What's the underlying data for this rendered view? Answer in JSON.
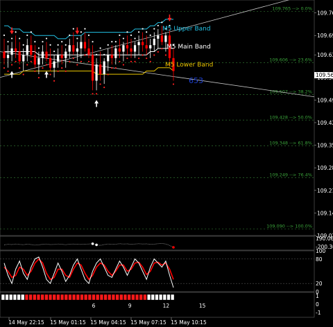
{
  "colors": {
    "background": "#000000",
    "grid": "#2f6f2f",
    "candle_up": "#ffffff",
    "candle_down": "#ff0000",
    "upper_band": "#22c3e6",
    "main_band": "#ffffff",
    "lower_band": "#e8c400",
    "fib": "#3aa23a",
    "price_label_bg": "#ffffff",
    "counter": "#1e40d0",
    "stoch_main": "#ffffff",
    "stoch_signal": "#ff0000"
  },
  "main_chart": {
    "current_price_label": "109.56",
    "countdown": "653",
    "band_labels": {
      "upper": "M5 Upper Band",
      "main": "M5 Main Band",
      "lower": "M5 Lower Band"
    }
  },
  "fib_labels": [
    {
      "text": "109.765 --> 0.0%",
      "price": 109.765
    },
    {
      "text": "109.606 --> 23.6%",
      "price": 109.606
    },
    {
      "text": "109.507 --> 38.2%",
      "price": 109.507
    },
    {
      "text": "109.428 --> 50.0%",
      "price": 109.428
    },
    {
      "text": "109.348 --> 61.8%",
      "price": 109.348
    },
    {
      "text": "109.249 --> 76.4%",
      "price": 109.249
    },
    {
      "text": "109.090 --> 100.0%",
      "price": 109.09
    }
  ],
  "chart_data": {
    "type": "line",
    "title": "",
    "y_ticks": [
      "109.76",
      "109.69",
      "109.63",
      "109.56",
      "109.49",
      "109.42",
      "109.35",
      "109.28",
      "109.21",
      "109.14",
      "109.07"
    ],
    "ylim": [
      109.07,
      109.8
    ],
    "x_ticks": [
      "14 May 22:15",
      "15 May 01:15",
      "15 May 04:15",
      "15 May 07:15",
      "15 May 10:15"
    ],
    "candles": [
      [
        109.64,
        109.68,
        109.6,
        109.62
      ],
      [
        109.62,
        109.66,
        109.59,
        109.63
      ],
      [
        109.63,
        109.67,
        109.61,
        109.65
      ],
      [
        109.65,
        109.69,
        109.62,
        109.64
      ],
      [
        109.64,
        109.67,
        109.6,
        109.61
      ],
      [
        109.61,
        109.65,
        109.58,
        109.63
      ],
      [
        109.63,
        109.68,
        109.61,
        109.66
      ],
      [
        109.66,
        109.69,
        109.62,
        109.63
      ],
      [
        109.63,
        109.66,
        109.59,
        109.6
      ],
      [
        109.6,
        109.64,
        109.57,
        109.62
      ],
      [
        109.62,
        109.66,
        109.6,
        109.64
      ],
      [
        109.64,
        109.67,
        109.61,
        109.62
      ],
      [
        109.62,
        109.65,
        109.58,
        109.59
      ],
      [
        109.59,
        109.63,
        109.56,
        109.61
      ],
      [
        109.61,
        109.65,
        109.59,
        109.63
      ],
      [
        109.63,
        109.66,
        109.6,
        109.62
      ],
      [
        109.62,
        109.65,
        109.59,
        109.64
      ],
      [
        109.64,
        109.68,
        109.62,
        109.66
      ],
      [
        109.66,
        109.7,
        109.63,
        109.64
      ],
      [
        109.64,
        109.67,
        109.61,
        109.65
      ],
      [
        109.65,
        109.69,
        109.62,
        109.67
      ],
      [
        109.67,
        109.7,
        109.64,
        109.65
      ],
      [
        109.65,
        109.68,
        109.62,
        109.63
      ],
      [
        109.63,
        109.66,
        109.52,
        109.55
      ],
      [
        109.55,
        109.62,
        109.52,
        109.6
      ],
      [
        109.6,
        109.64,
        109.55,
        109.57
      ],
      [
        109.57,
        109.62,
        109.54,
        109.61
      ],
      [
        109.61,
        109.65,
        109.58,
        109.63
      ],
      [
        109.63,
        109.66,
        109.6,
        109.62
      ],
      [
        109.62,
        109.66,
        109.6,
        109.65
      ],
      [
        109.65,
        109.68,
        109.62,
        109.64
      ],
      [
        109.64,
        109.67,
        109.61,
        109.66
      ],
      [
        109.66,
        109.69,
        109.63,
        109.65
      ],
      [
        109.65,
        109.68,
        109.62,
        109.64
      ],
      [
        109.64,
        109.67,
        109.62,
        109.66
      ],
      [
        109.66,
        109.69,
        109.63,
        109.67
      ],
      [
        109.67,
        109.7,
        109.64,
        109.66
      ],
      [
        109.66,
        109.69,
        109.63,
        109.65
      ],
      [
        109.65,
        109.68,
        109.62,
        109.66
      ],
      [
        109.66,
        109.7,
        109.64,
        109.68
      ],
      [
        109.68,
        109.71,
        109.65,
        109.69
      ],
      [
        109.69,
        109.72,
        109.66,
        109.67
      ],
      [
        109.67,
        109.7,
        109.64,
        109.69
      ],
      [
        109.69,
        109.71,
        109.61,
        109.62
      ],
      [
        109.62,
        109.65,
        109.55,
        109.58
      ]
    ],
    "upper_band": [
      109.72,
      109.72,
      109.71,
      109.71,
      109.71,
      109.7,
      109.7,
      109.7,
      109.69,
      109.69,
      109.69,
      109.69,
      109.69,
      109.69,
      109.68,
      109.68,
      109.68,
      109.69,
      109.69,
      109.69,
      109.69,
      109.7,
      109.7,
      109.7,
      109.7,
      109.7,
      109.7,
      109.7,
      109.7,
      109.7,
      109.7,
      109.7,
      109.7,
      109.7,
      109.71,
      109.71,
      109.71,
      109.71,
      109.72,
      109.72,
      109.73,
      109.73,
      109.74,
      109.74,
      109.74
    ],
    "main_band": [
      109.64,
      109.64,
      109.64,
      109.64,
      109.64,
      109.64,
      109.64,
      109.64,
      109.64,
      109.63,
      109.63,
      109.63,
      109.63,
      109.63,
      109.63,
      109.63,
      109.63,
      109.63,
      109.63,
      109.63,
      109.63,
      109.63,
      109.63,
      109.63,
      109.63,
      109.63,
      109.63,
      109.63,
      109.63,
      109.63,
      109.63,
      109.63,
      109.63,
      109.63,
      109.63,
      109.63,
      109.63,
      109.63,
      109.64,
      109.64,
      109.65,
      109.65,
      109.65,
      109.65,
      109.65
    ],
    "lower_band": [
      109.57,
      109.57,
      109.57,
      109.57,
      109.57,
      109.58,
      109.58,
      109.58,
      109.58,
      109.58,
      109.58,
      109.58,
      109.58,
      109.58,
      109.58,
      109.58,
      109.58,
      109.58,
      109.58,
      109.58,
      109.58,
      109.58,
      109.58,
      109.58,
      109.57,
      109.57,
      109.57,
      109.57,
      109.57,
      109.57,
      109.57,
      109.57,
      109.57,
      109.57,
      109.57,
      109.57,
      109.57,
      109.58,
      109.58,
      109.58,
      109.59,
      109.59,
      109.59,
      109.59,
      109.58
    ],
    "trend_line_up": {
      "from_price": 109.56,
      "to_price": 109.8
    },
    "trend_line_down": {
      "from_price": 109.64,
      "to_price": 109.5
    },
    "cci_panel": {
      "labels": [
        "190.064",
        "-200.30"
      ],
      "values": [
        -60,
        -40,
        -50,
        -30,
        -45,
        -55,
        -35,
        -50,
        -70,
        -60,
        -40,
        -30,
        -50,
        -45,
        -30,
        -40,
        -55,
        -35,
        -30,
        -40,
        -45,
        -35,
        -30,
        -20,
        -60,
        -80,
        -50,
        -30,
        -40,
        -35,
        -20,
        -30,
        -25,
        -40,
        -30,
        -20,
        -30,
        -25,
        -40,
        -35,
        -20,
        -10,
        -30,
        -80,
        -150
      ],
      "ylim": [
        -250,
        250
      ]
    },
    "stoch_panel": {
      "labels": [
        "100",
        "80",
        "20",
        "0"
      ],
      "main": [
        70,
        40,
        20,
        55,
        75,
        45,
        30,
        60,
        80,
        85,
        60,
        30,
        20,
        45,
        70,
        50,
        25,
        40,
        65,
        80,
        55,
        30,
        20,
        50,
        70,
        80,
        60,
        40,
        35,
        55,
        75,
        60,
        40,
        60,
        80,
        70,
        50,
        30,
        60,
        80,
        70,
        60,
        75,
        40,
        10
      ],
      "signal": [
        60,
        50,
        35,
        40,
        60,
        55,
        40,
        50,
        70,
        80,
        70,
        45,
        30,
        35,
        55,
        55,
        40,
        35,
        55,
        70,
        65,
        45,
        30,
        40,
        60,
        70,
        65,
        50,
        40,
        50,
        65,
        65,
        50,
        55,
        70,
        72,
        60,
        42,
        50,
        70,
        72,
        65,
        70,
        55,
        30
      ]
    },
    "bar_panel": {
      "labels": [
        "6",
        "9",
        "12",
        "15"
      ],
      "axis_values": [
        "1",
        "0",
        "-1"
      ],
      "states": [
        0,
        0,
        0,
        0,
        0,
        0,
        1,
        1,
        1,
        1,
        1,
        1,
        1,
        1,
        1,
        1,
        1,
        1,
        1,
        1,
        1,
        1,
        1,
        1,
        1,
        1,
        1,
        1,
        1,
        1,
        1,
        1,
        1,
        1,
        1,
        1,
        1,
        0,
        0,
        0,
        0,
        0,
        0,
        0
      ]
    }
  }
}
